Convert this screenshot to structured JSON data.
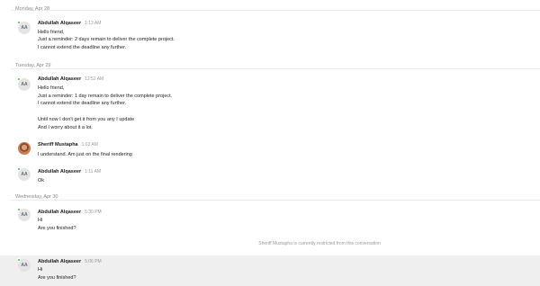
{
  "days": [
    {
      "label": "Monday, Apr 28"
    },
    {
      "label": "Tuesday, Apr 29"
    },
    {
      "label": "Wednesday, Apr 30"
    }
  ],
  "messages": [
    {
      "sender": "Abdullah Alqaseer",
      "initials": "AA",
      "time": "1:13 AM",
      "lines": [
        "Hello friend,",
        "Just a reminder: 2 days remain to deliver the complete project.",
        "I cannot extend the deadline any further."
      ]
    },
    {
      "sender": "Abdullah Alqaseer",
      "initials": "AA",
      "time": "12:52 AM",
      "lines": [
        "Hello friend,",
        "Just a reminder: 1 day remain to deliver the complete project.",
        "I cannot extend the deadline any further.",
        "Until now I don't get it from you any I update",
        "And I worry about it a lot."
      ]
    },
    {
      "sender": "Sheriff Mustapha",
      "time": "1:03 AM",
      "lines": [
        "I understand. Am just on the final rendering"
      ]
    },
    {
      "sender": "Abdullah Alqaseer",
      "initials": "AA",
      "time": "1:11 AM",
      "lines": [
        "Ok"
      ]
    },
    {
      "sender": "Abdullah Alqaseer",
      "initials": "AA",
      "time": "5:30 PM",
      "lines": [
        "Hi",
        "Are you finished?"
      ]
    },
    {
      "sender": "Abdullah Alqaseer",
      "initials": "AA",
      "time": "5:06 PM",
      "lines": [
        "Hi",
        "Are you finished?"
      ]
    }
  ],
  "notice": "Sheriff Mustapha is currently restricted from this conversation",
  "colors": {
    "online": "#2ecc40",
    "highlight_bg": "#efefef"
  }
}
